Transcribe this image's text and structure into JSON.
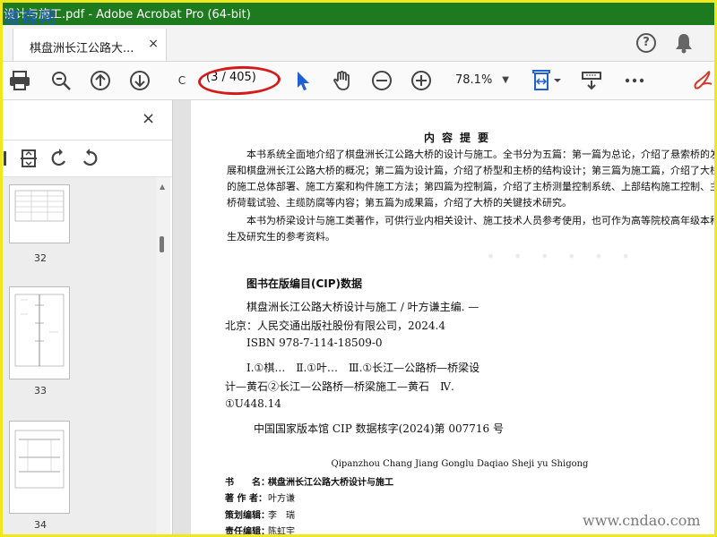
{
  "window": {
    "title": "设计与施工.pdf - Adobe Acrobat Pro (64-bit)",
    "watermark_text": "道森网"
  },
  "tabs": [
    {
      "label": "棋盘洲长江公路大...",
      "close": "×"
    }
  ],
  "header_icons": {
    "help": "?",
    "bell": "bell-icon"
  },
  "toolbar": {
    "page_input": "C",
    "page_count": "(3 / 405)",
    "zoom": "78.1%",
    "zoom_arrow": "▼"
  },
  "sidepanel": {
    "close": "×",
    "thumbnails": [
      {
        "page": "32"
      },
      {
        "page": "33"
      },
      {
        "page": "34"
      }
    ],
    "collapse": "◀"
  },
  "document": {
    "heading": "内容提要",
    "paragraphs": [
      "本书系统全面地介绍了棋盘洲长江公路大桥的设计与施工。全书分为五篇：第一篇为总论，介绍了悬索桥的发展和棋盘洲长江公路大桥的概况；第二篇为设计篇，介绍了桥型和主桥的结构设计；第三篇为施工篇，介绍了大桥的施工总体部署、施工方案和构件施工方法；第四篇为控制篇，介绍了主桥测量控制系统、上部结构施工控制、主桥荷载试验、主缆防腐等内容；第五篇为成果篇，介绍了大桥的关键技术研究。",
      "本书为桥梁设计与施工类著作，可供行业内相关设计、施工技术人员参考使用，也可作为高等院校高年级本科生及研究生的参考资料。"
    ],
    "cip_title": "图书在版编目(CIP)数据",
    "cip_lines": [
      "棋盘洲长江公路大桥设计与施工 / 叶方谦主编. —",
      "北京：人民交通出版社股份有限公司，2024.4",
      "ISBN 978-7-114-18509-0",
      "Ⅰ.①棋…　Ⅱ.①叶…　Ⅲ.①长江—公路桥—桥梁设",
      "计—黄石②长江—公路桥—桥梁施工—黄石　Ⅳ.",
      "①U448.14",
      "中国国家版本馆 CIP 数据核字(2024)第 007716 号"
    ],
    "pinyin": "Qipanzhou Chang Jiang Gonglu Daqiao Sheji yu Shigong",
    "meta": [
      {
        "key": "书　　名：",
        "value": "棋盘洲长江公路大桥设计与施工"
      },
      {
        "key": "著 作 者：",
        "value": "叶方谦"
      },
      {
        "key": "策划编辑：",
        "value": "李　瑞"
      },
      {
        "key": "责任编辑：",
        "value": "陈虹宇"
      }
    ]
  },
  "site_watermark": "www.cndao.com",
  "colors": {
    "titlebar": "#1e7a1e",
    "frame": "#f0e81c",
    "accent_blue": "#1f5fd1",
    "annotation_red": "#d41a1a"
  }
}
